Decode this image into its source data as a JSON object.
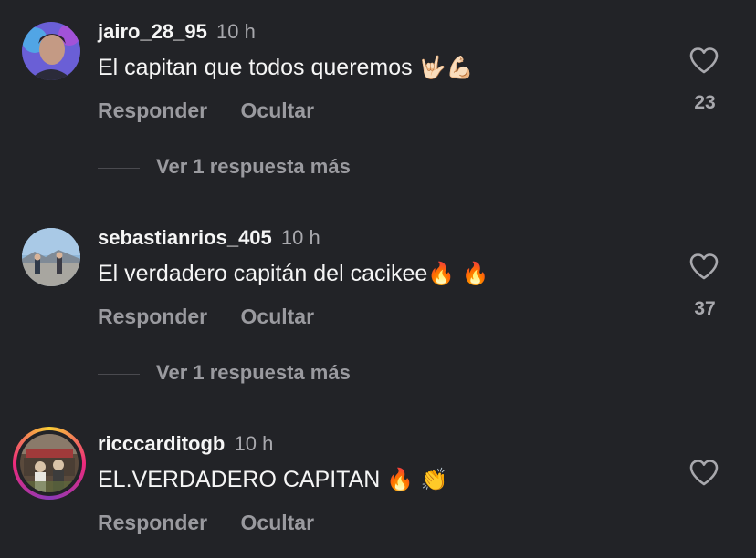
{
  "comments": [
    {
      "username": "jairo_28_95",
      "time": "10 h",
      "text": "El capitan que todos queremos ",
      "emojis": "🤟🏻💪🏻",
      "reply_label": "Responder",
      "hide_label": "Ocultar",
      "likes": "23",
      "more_replies": "Ver 1 respuesta más"
    },
    {
      "username": "sebastianrios_405",
      "time": "10 h",
      "text": "El verdadero capitán del cacikee",
      "emojis": "🔥 🔥",
      "reply_label": "Responder",
      "hide_label": "Ocultar",
      "likes": "37",
      "more_replies": "Ver 1 respuesta más"
    },
    {
      "username": "ricccarditogb",
      "time": "10 h",
      "text": "EL.VERDADERO CAPITAN ",
      "emojis": "🔥 👏",
      "reply_label": "Responder",
      "hide_label": "Ocultar"
    }
  ],
  "colors": {
    "background": "#222327",
    "primary_text": "#f5f5f5",
    "secondary_text": "#9a9a9f",
    "story_ring": [
      "#f9ce34",
      "#ee2a7b",
      "#8a3ab9"
    ]
  },
  "icons": {
    "like": "heart-outline-icon"
  }
}
